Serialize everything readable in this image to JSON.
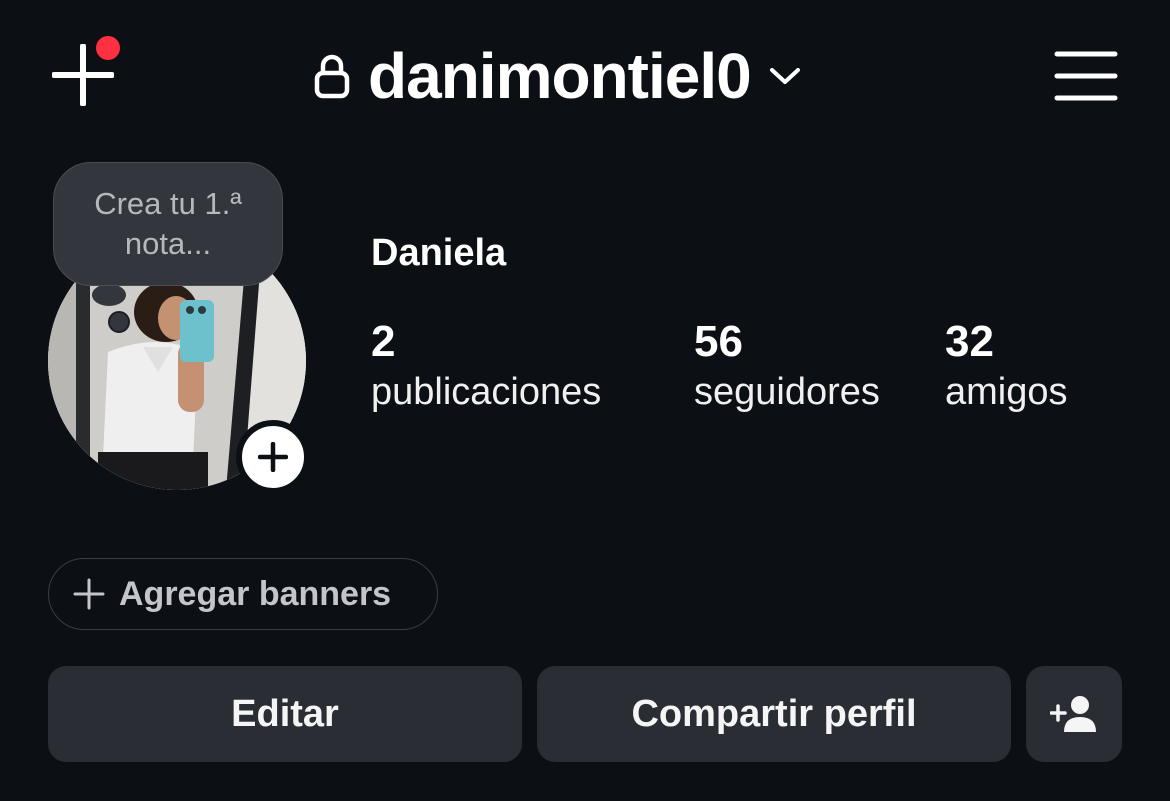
{
  "header": {
    "username": "danimontiel0",
    "icons": {
      "create": "plus-icon",
      "notification": "red-dot",
      "lock": "lock-icon",
      "chevron": "chevron-down-icon",
      "menu": "hamburger-menu-icon"
    },
    "notification_color": "#ff3040"
  },
  "profile": {
    "note_prompt": "Crea tu 1.ª nota...",
    "display_name": "Daniela",
    "stats": [
      {
        "value": "2",
        "label": "publicaciones"
      },
      {
        "value": "56",
        "label": "seguidores"
      },
      {
        "value": "32",
        "label": "amigos"
      }
    ]
  },
  "actions": {
    "add_banners": "Agregar banners",
    "edit": "Editar",
    "share_profile": "Compartir perfil",
    "add_person_icon": "add-person-icon"
  },
  "colors": {
    "background": "#0c0f14",
    "button_background": "#2a2d33",
    "note_bubble": "#33363d"
  }
}
